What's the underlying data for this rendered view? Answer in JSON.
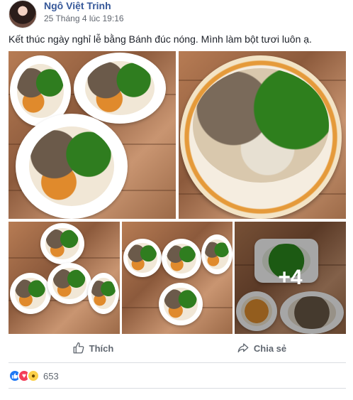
{
  "post": {
    "author": "Ngô Việt Trinh",
    "timestamp": "25 Tháng 4 lúc 19:16",
    "caption": "Kết thúc ngày nghỉ lễ bằng Bánh đúc nóng. Mình làm bột tươi luôn ạ.",
    "more_photos": "+4"
  },
  "actions": {
    "like_label": "Thích",
    "share_label": "Chia sẻ"
  },
  "reactions": {
    "icons": [
      "like-icon",
      "love-icon",
      "wow-icon"
    ],
    "count": "653"
  },
  "colors": {
    "link": "#365899",
    "like": "#2078f4",
    "love": "#f33e58",
    "wow": "#fcd049"
  }
}
